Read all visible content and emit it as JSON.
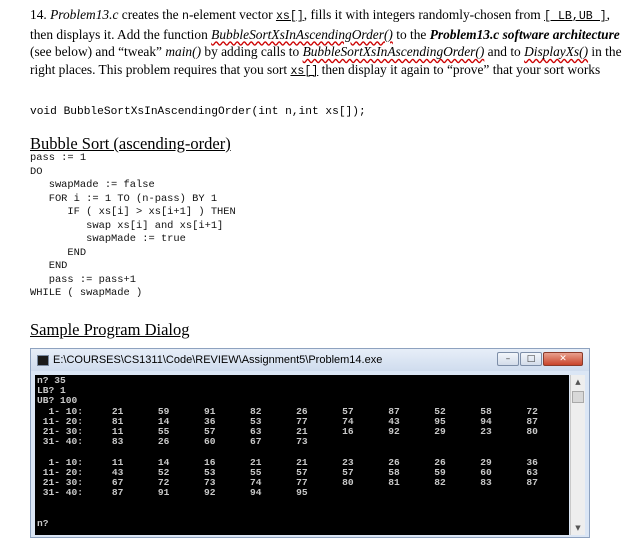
{
  "problem": {
    "p1": "14. ",
    "p2": "Problem13.c",
    "p3": " creates the ",
    "p4": "n",
    "p5": "-element vector ",
    "p6": "xs[]",
    "p7": ", fills it with integers randomly-chosen from ",
    "p8": "[ LB,UB ]",
    "p9": ", then displays it. Add the function ",
    "p10": "BubbleSortXsInAscendingOrder()",
    "p11": " to the ",
    "p12": "Problem13.c software architecture",
    "p13": " (see below) and “tweak” ",
    "p14": "main()",
    "p15": " by adding calls to ",
    "p16": "BubbleSortXsInAscendingOrder()",
    "p17": " and to ",
    "p18": "DisplayXs()",
    "p19": " in the right places. This problem requires that you sort ",
    "p20": "xs[]",
    "p21": " then display it again to “prove” that your sort works"
  },
  "prototype": "void BubbleSortXsInAscendingOrder(int n,int xs[]);",
  "bubble_heading": "Bubble Sort (ascending-order)",
  "pseudocode": [
    "pass := 1",
    "DO",
    "   swapMade := false",
    "   FOR i := 1 TO (n-pass) BY 1",
    "      IF ( xs[i] > xs[i+1] ) THEN",
    "         swap xs[i] and xs[i+1]",
    "         swapMade := true",
    "      END",
    "   END",
    "   pass := pass+1",
    "WHILE ( swapMade )"
  ],
  "sample_heading": "Sample Program Dialog",
  "window": {
    "title": "E:\\COURSES\\CS1311\\Code\\REVIEW\\Assignment5\\Problem14.exe",
    "min_label": "–",
    "max_label": "□",
    "close_label": "✕",
    "scroll_up": "▲",
    "scroll_down": "▼"
  },
  "console_lines": [
    "n? 35",
    "LB? 1",
    "UB? 100",
    "  1- 10:     21      59      91      82      26      57      87      52      58      72",
    " 11- 20:     81      14      36      53      77      74      43      95      94      87",
    " 21- 30:     11      55      57      63      21      16      92      29      23      80",
    " 31- 40:     83      26      60      67      73",
    "",
    "  1- 10:     11      14      16      21      21      23      26      26      29      36",
    " 11- 20:     43      52      53      55      57      57      58      59      60      63",
    " 21- 30:     67      72      73      74      77      80      81      82      83      87",
    " 31- 40:     87      91      92      94      95",
    "",
    "",
    "n?"
  ]
}
